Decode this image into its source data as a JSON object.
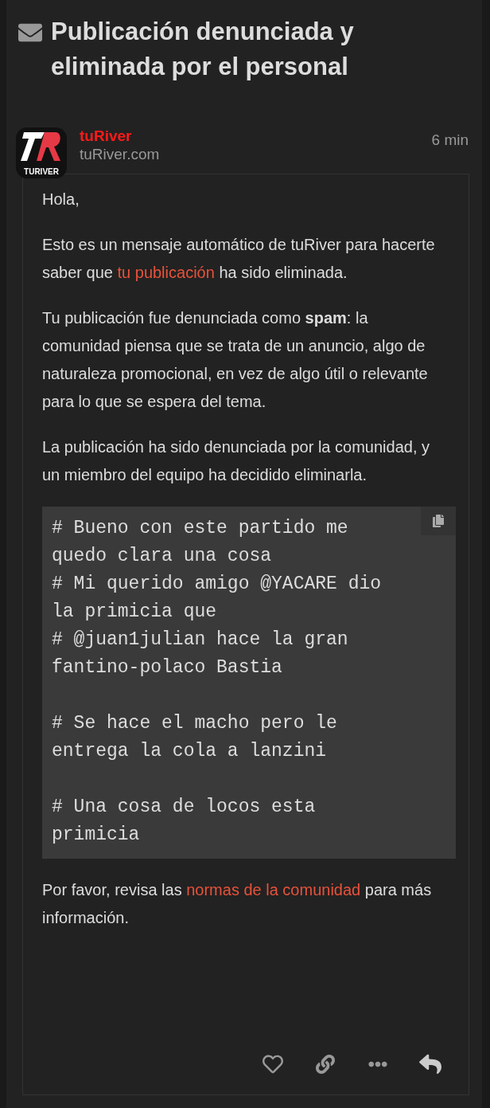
{
  "title": "Publicación denunciada y eliminada por el personal",
  "post": {
    "author": "tuRiver",
    "subtitle": "tuRiver.com",
    "time": "6 min",
    "avatar_text": "TURIVER",
    "paragraphs": [
      [
        {
          "kind": "text",
          "text": "Hola,"
        }
      ],
      [
        {
          "kind": "text",
          "text": "Esto es un mensaje automático de tuRiver para hacerte saber que "
        },
        {
          "kind": "link",
          "text": "tu publicación"
        },
        {
          "kind": "text",
          "text": " ha sido eliminada."
        }
      ],
      [
        {
          "kind": "text",
          "text": "Tu publicación fue denunciada como "
        },
        {
          "kind": "bold",
          "text": "spam"
        },
        {
          "kind": "text",
          "text": ": la comunidad piensa que se trata de un anuncio, algo de naturaleza promocional, en vez de algo útil o relevante para lo que se espera del tema."
        }
      ],
      [
        {
          "kind": "text",
          "text": "La publicación ha sido denunciada por la comunidad, y un miembro del equipo ha decidido eliminarla."
        }
      ]
    ],
    "code": "# Bueno con este partido me quedo clara una cosa\n# Mi querido amigo @YACARE dio la primicia que\n# @juan1julian hace la gran fantino-polaco Bastia\n\n# Se hace el macho pero le entrega la cola a lanzini\n\n# Una cosa de locos esta primicia",
    "closing": [
      {
        "kind": "text",
        "text": "Por favor, revisa las "
      },
      {
        "kind": "link",
        "text": "normas de la comunidad"
      },
      {
        "kind": "text",
        "text": " para más información."
      }
    ]
  }
}
